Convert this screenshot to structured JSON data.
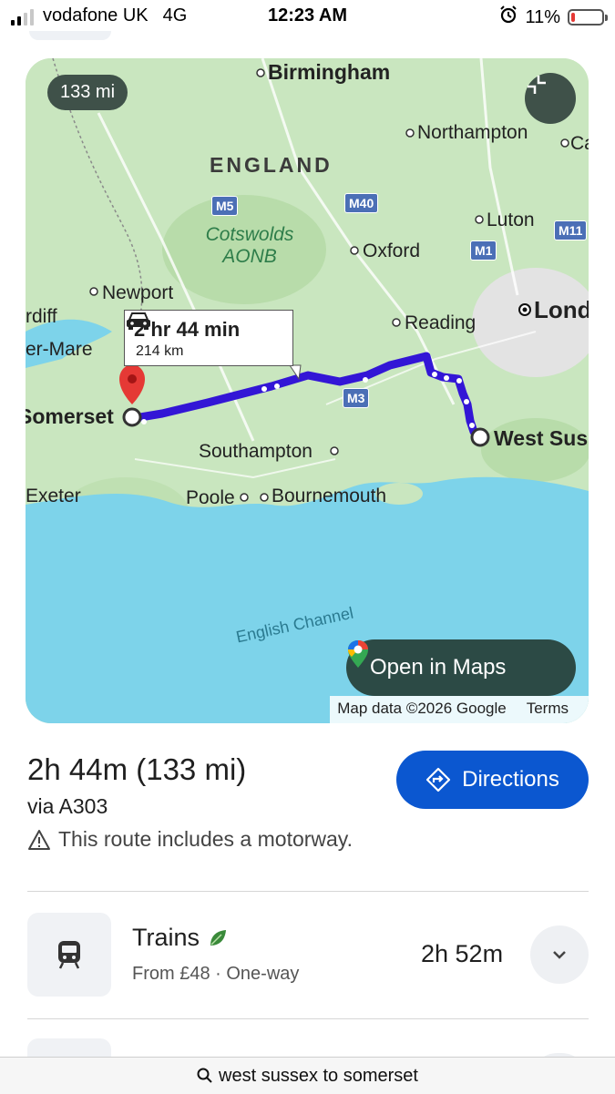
{
  "status_bar": {
    "carrier": "vodafone UK",
    "network": "4G",
    "time": "12:23 AM",
    "battery": "11%",
    "battery_level": 0.11
  },
  "map": {
    "distance_chip": "133 mi",
    "callout_time": "2 hr 44 min",
    "callout_distance": "214 km",
    "labels": {
      "birmingham": "Birmingham",
      "northampton": "Northampton",
      "cambridge": "Ca",
      "england": "ENGLAND",
      "cotswolds": "Cotswolds",
      "aonb": "AONB",
      "oxford": "Oxford",
      "luton": "Luton",
      "newport": "Newport",
      "cardiff": "rdiff",
      "weston": "er-Mare",
      "reading": "Reading",
      "london": "Lond",
      "somerset": "Somerset",
      "west_sussex": "West Sus",
      "southampton": "Southampton",
      "exeter": "Exeter",
      "poole": "Poole",
      "bournemouth": "Bournemouth",
      "channel": "English Channel"
    },
    "motorways": {
      "m5": "M5",
      "m40": "M40",
      "m1": "M1",
      "m11": "M11",
      "m3": "M3"
    },
    "open_in_maps": "Open in Maps",
    "attribution": "Map data ©2026 Google",
    "terms": "Terms"
  },
  "route": {
    "summary": "2h 44m (133 mi)",
    "via": "via A303",
    "warning": "This route includes a motorway.",
    "directions_label": "Directions"
  },
  "alternatives": [
    {
      "title": "Trains",
      "subtitle": "From £48 · One-way",
      "duration": "2h 52m"
    }
  ],
  "search_bar": {
    "query": "west sussex to somerset"
  },
  "colors": {
    "route": "#3316d6",
    "directions_button": "#0b57d0",
    "sea": "#7dd3ea",
    "land": "#c9e6bf"
  }
}
